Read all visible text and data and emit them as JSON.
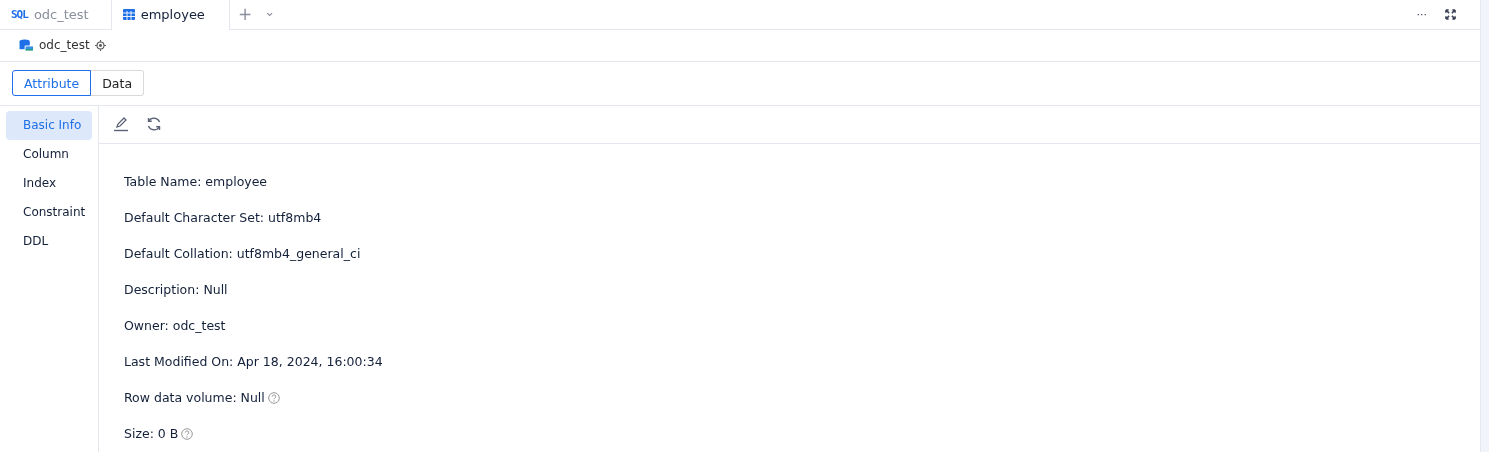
{
  "tabs": [
    {
      "kind": "sql",
      "badge": "SQL",
      "label": "odc_test",
      "selected": false
    },
    {
      "kind": "table",
      "label": "employee",
      "selected": true
    }
  ],
  "tab_actions": {
    "add": "+",
    "more": "⌄"
  },
  "window_actions": {
    "more": "···"
  },
  "breadcrumb": {
    "database": "odc_test"
  },
  "view_tabs": [
    {
      "label": "Attribute",
      "selected": true
    },
    {
      "label": "Data",
      "selected": false
    }
  ],
  "sidebar": {
    "items": [
      {
        "label": "Basic Info",
        "selected": true
      },
      {
        "label": "Column",
        "selected": false
      },
      {
        "label": "Index",
        "selected": false
      },
      {
        "label": "Constraint",
        "selected": false
      },
      {
        "label": "DDL",
        "selected": false
      }
    ]
  },
  "properties": [
    {
      "label": "Table Name:",
      "value": "employee",
      "help": false
    },
    {
      "label": "Default Character Set:",
      "value": "utf8mb4",
      "help": false
    },
    {
      "label": "Default Collation:",
      "value": "utf8mb4_general_ci",
      "help": false
    },
    {
      "label": "Description:",
      "value": "Null",
      "help": false
    },
    {
      "label": "Owner:",
      "value": "odc_test",
      "help": false
    },
    {
      "label": "Last Modified On:",
      "value": "Apr 18, 2024, 16:00:34",
      "help": false
    },
    {
      "label": "Row data volume:",
      "value": "Null",
      "help": true
    },
    {
      "label": "Size:",
      "value": "0 B",
      "help": true
    }
  ]
}
